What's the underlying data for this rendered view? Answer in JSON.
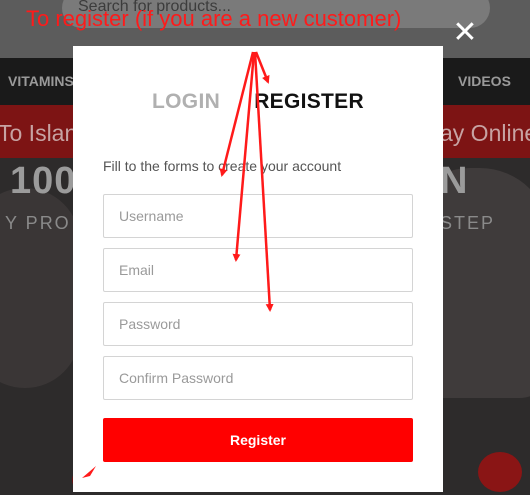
{
  "background": {
    "search_placeholder": "Search for products...",
    "nav_left": "VITAMINS",
    "nav_right": "VIDEOS",
    "promo_left": "To Islandw",
    "promo_right": "ay Online",
    "hero_line1_left": "100",
    "hero_line1_right": "N",
    "hero_line2_left": "Y PRO",
    "hero_line2_right": "STEP"
  },
  "modal": {
    "tabs": {
      "login": "LOGIN",
      "register": "REGISTER",
      "active": "register"
    },
    "intro": "Fill to the forms to create your account",
    "fields": {
      "username_placeholder": "Username",
      "email_placeholder": "Email",
      "password_placeholder": "Password",
      "confirm_password_placeholder": "Confirm Password"
    },
    "register_button": "Register",
    "close_icon": "close-icon",
    "accent_color": "#ff0000"
  },
  "annotation": {
    "text": "To register (if you are a new customer)",
    "color": "#ff1a1a"
  }
}
